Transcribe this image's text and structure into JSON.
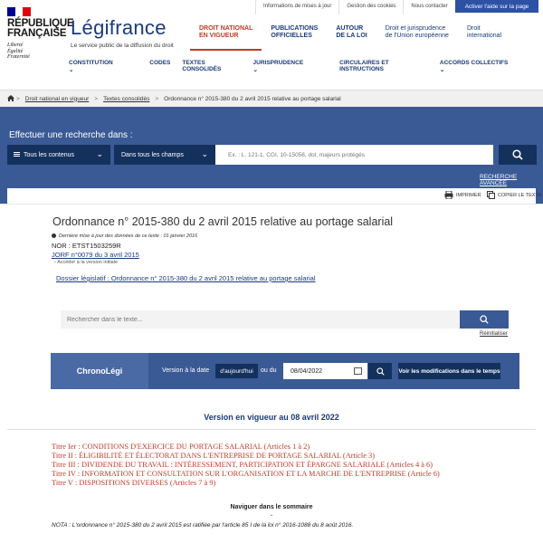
{
  "header": {
    "republic_line1": "RÉPUBLIQUE",
    "republic_line2": "FRANÇAISE",
    "motto1": "Liberté",
    "motto2": "Égalité",
    "motto3": "Fraternité",
    "flag_colors": [
      "#000091",
      "#ffffff",
      "#e1000f"
    ],
    "site_title": "Légifrance",
    "site_tagline": "Le service public de la diffusion du droit",
    "top_links": [
      "Informations de mises à jour",
      "Gestion des cookies",
      "Nous contacter"
    ],
    "help_button": "Activer l'aide sur la page",
    "nav": [
      {
        "line1": "DROIT NATIONAL",
        "line2": "EN VIGUEUR"
      },
      {
        "line1": "PUBLICATIONS",
        "line2": "OFFICIELLES"
      },
      {
        "line1": "AUTOUR",
        "line2": "DE LA LOI"
      },
      {
        "line1": "Droit et jurisprudence",
        "line2": "de l'Union européenne"
      },
      {
        "line1": "Droit",
        "line2": "international"
      }
    ],
    "subnav": [
      "CONSTITUTION",
      "CODES",
      "TEXTES CONSOLIDÉS",
      "JURISPRUDENCE",
      "CIRCULAIRES ET INSTRUCTIONS",
      "ACCORDS COLLECTIFS"
    ],
    "subnav_chevron": "⌄"
  },
  "breadcrumb": {
    "home_icon": "home-icon",
    "items": [
      "Droit national en vigueur",
      "Textes consolidés",
      "Ordonnance n° 2015-380 du 2 avril 2015 relative au portage salarial"
    ],
    "separator": ">"
  },
  "search": {
    "title": "Effectuer une recherche dans :",
    "scope_select": "Tous les contenus",
    "field_select": "Dans tous les champs",
    "placeholder": "Ex. : L. 121-1, CGI, 10-15056, dol, majeurs protégés",
    "advanced_link": "RECHERCHE AVANCÉE",
    "chevron": "⌄"
  },
  "toolbar": {
    "print": "IMPRIMER",
    "copy": "COPIER LE TEXTE"
  },
  "document": {
    "title": "Ordonnance n° 2015-380 du 2 avril 2015 relative au portage salarial",
    "last_update": "Dernière mise à jour des données de ce texte : 01 janvier 2016",
    "nor": "NOR : ETST1503259R",
    "jorf": "JORF n°0079 du 3 avril 2015",
    "initial_version": "Accéder à la version initiale",
    "dossier": "Dossier législatif : Ordonnance n° 2015-380 du 2 avril 2015 relative au portage salarial"
  },
  "text_search": {
    "placeholder": "Rechercher dans le texte...",
    "reset": "Réinitialiser"
  },
  "chronolegi": {
    "title": "ChronoLégi",
    "version_label": "Version à la date",
    "today_button": "d'aujourd'hui",
    "or_label": "ou du",
    "date_value": "08/04/2022",
    "changes_button": "Voir les modifications dans le temps"
  },
  "version_heading": "Version en vigueur au 08 avril 2022",
  "titles": [
    "Titre Ier : CONDITIONS D'EXERCICE DU PORTAGE SALARIAL (Articles 1 à 2)",
    "Titre II : ÉLIGIBILITÉ ET ÉLECTORAT DANS L'ENTREPRISE DE PORTAGE SALARIAL (Article 3)",
    "Titre III : DIVIDENDE DU TRAVAIL : INTÉRESSEMENT, PARTICIPATION ET ÉPARGNE SALARIALE (Articles 4 à 6)",
    "Titre IV : INFORMATION ET CONSULTATION SUR L'ORGANISATION ET LA MARCHE DE L'ENTREPRISE (Article 6)",
    "Titre V : DISPOSITIONS DIVERSES (Articles 7 à 9)"
  ],
  "summary_nav": "Naviguer dans le sommaire",
  "summary_arrow": "⌄",
  "nota": "NOTA : L'ordonnance n° 2015-380 du 2 avril 2015 est ratifiée par l'article 85 I de la loi n° 2016-1088 du 8 août 2016."
}
